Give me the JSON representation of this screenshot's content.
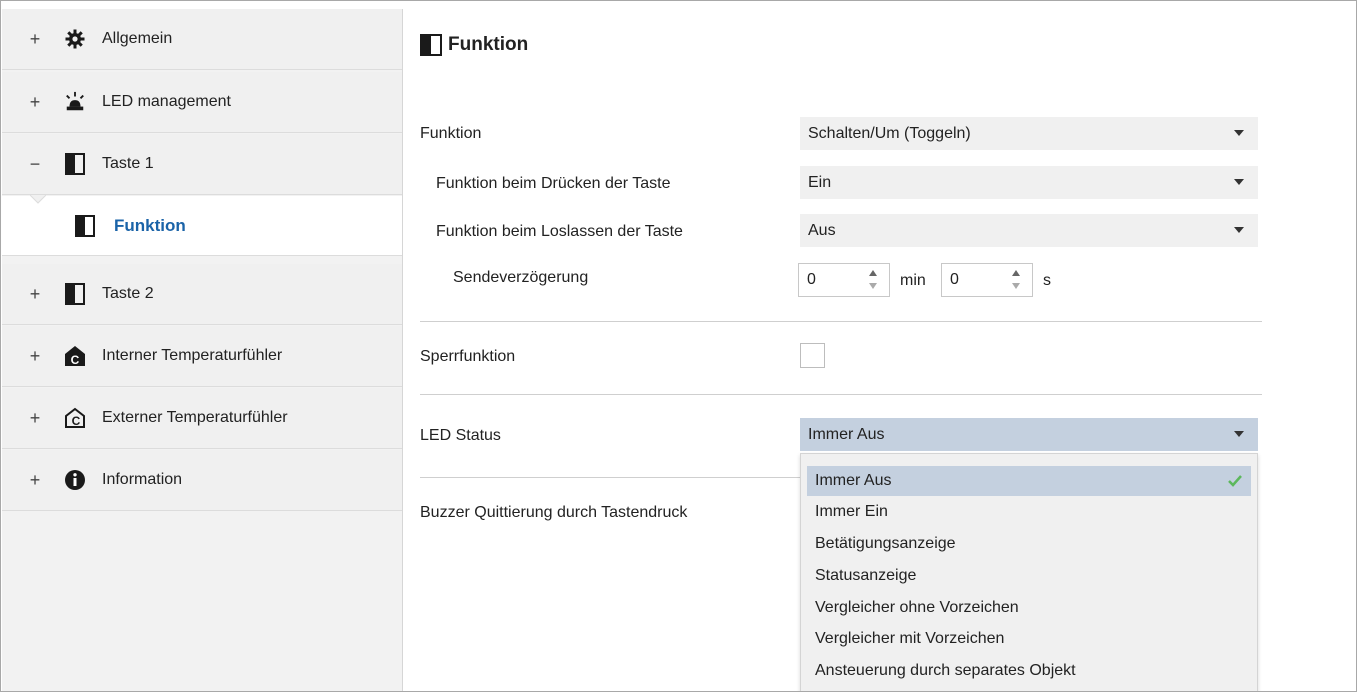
{
  "sidebar": {
    "items": [
      {
        "label": "Allgemein",
        "expander": "+",
        "icon": "gear-icon"
      },
      {
        "label": "LED management",
        "expander": "+",
        "icon": "led-icon"
      },
      {
        "label": "Taste 1",
        "expander": "−",
        "icon": "button-panel-icon"
      },
      {
        "label": "Funktion",
        "icon": "button-panel-icon",
        "selected": true
      },
      {
        "label": "Taste 2",
        "expander": "+",
        "icon": "button-panel-icon"
      },
      {
        "label": "Interner Temperaturfühler",
        "expander": "+",
        "icon": "internal-temperature-icon"
      },
      {
        "label": "Externer Temperaturfühler",
        "expander": "+",
        "icon": "external-temperature-icon"
      },
      {
        "label": "Information",
        "expander": "+",
        "icon": "info-icon"
      }
    ]
  },
  "main": {
    "title": "Funktion",
    "rows": {
      "funktion": {
        "label": "Funktion",
        "value": "Schalten/Um (Toggeln)"
      },
      "druecken": {
        "label": "Funktion beim Drücken der Taste",
        "value": "Ein"
      },
      "loslassen": {
        "label": "Funktion beim Loslassen der Taste",
        "value": "Aus"
      },
      "sendeverzoegerung": {
        "label": "Sendeverzögerung",
        "min_value": "0",
        "min_unit": "min",
        "sec_value": "0",
        "sec_unit": "s"
      },
      "sperrfunktion": {
        "label": "Sperrfunktion",
        "checked": false
      },
      "led_status": {
        "label": "LED Status",
        "value": "Immer Aus"
      },
      "buzzer": {
        "label": "Buzzer Quittierung durch Tastendruck"
      }
    },
    "led_status_options": [
      "Immer Aus",
      "Immer Ein",
      "Betätigungsanzeige",
      "Statusanzeige",
      "Vergleicher ohne Vorzeichen",
      "Vergleicher mit Vorzeichen",
      "Ansteuerung durch separates Objekt"
    ],
    "selected_option_index": 0
  },
  "colors": {
    "accent": "#1a63a8",
    "selected_bg": "#c4d0df",
    "check": "#5cb85c"
  }
}
